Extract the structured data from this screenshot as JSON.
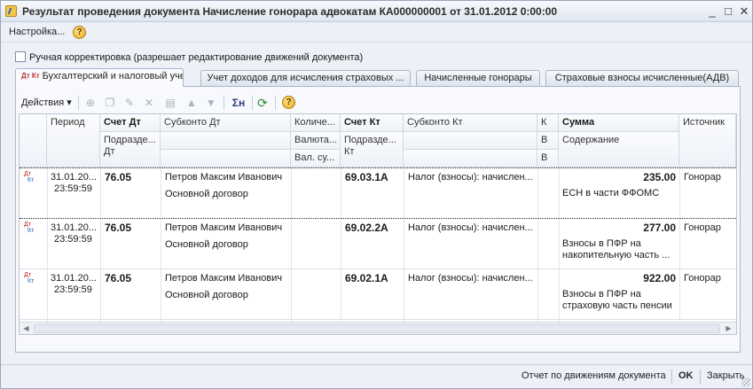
{
  "window": {
    "title": "Результат проведения документа Начисление гонорара адвокатам КА000000001 от 31.01.2012 0:00:00",
    "controls": {
      "minimize": "_",
      "maximize": "□",
      "close": "✕"
    }
  },
  "menu": {
    "settings_label": "Настройка...",
    "help": "?"
  },
  "manual_edit": {
    "label": "Ручная корректировка (разрешает редактирование движений документа)",
    "checked": false
  },
  "tabs": [
    {
      "label": "Бухгалтерский и налоговый учет",
      "icon": "Дт Кт",
      "active": true
    },
    {
      "label": "Учет доходов для исчисления страховых ...",
      "active": false
    },
    {
      "label": "Начисленные гонорары",
      "active": false
    },
    {
      "label": "Страховые взносы исчисленные(АДВ)",
      "active": false
    }
  ],
  "toolbar": {
    "actions_label": "Действия",
    "actions_arrow": "▾",
    "sum_label": "Σн",
    "help": "?"
  },
  "grid": {
    "headers": {
      "period": "Период",
      "account_dt": "Счет Дт",
      "subconto_dt": "Субконто Дт",
      "quantity": "Количе...",
      "account_kt": "Счет Кт",
      "subconto_kt": "Субконто Кт",
      "k": "К",
      "sum": "Сумма",
      "source": "Источник",
      "division_dt": "Подразде...",
      "dt": "Дт",
      "currency": "Валюта...",
      "division_kt": "Подразде...",
      "kt": "Кт",
      "v1": "В",
      "content": "Содержание",
      "val_sum": "Вал. су...",
      "v2": "В"
    },
    "rows": [
      {
        "icon_dt": "Дт",
        "icon_kt": "Кт",
        "period_date": "31.01.20...",
        "period_time": "23:59:59",
        "account_dt": "76.05",
        "subconto_dt_1": "Петров Максим Иванович",
        "subconto_dt_2": "Основной договор",
        "account_kt": "69.03.1А",
        "subconto_kt": "Налог (взносы): начислен...",
        "sum": "235.00",
        "content": "ЕСН в части ФФОМС",
        "source": "Гонорар"
      },
      {
        "icon_dt": "Дт",
        "icon_kt": "Кт",
        "period_date": "31.01.20...",
        "period_time": "23:59:59",
        "account_dt": "76.05",
        "subconto_dt_1": "Петров Максим Иванович",
        "subconto_dt_2": "Основной договор",
        "account_kt": "69.02.2А",
        "subconto_kt": "Налог (взносы): начислен...",
        "sum": "277.00",
        "content": "Взносы в ПФР на накопительную часть ...",
        "source": "Гонорар"
      },
      {
        "icon_dt": "Дт",
        "icon_kt": "Кт",
        "period_date": "31.01.20...",
        "period_time": "23:59:59",
        "account_dt": "76.05",
        "subconto_dt_1": "Петров Максим Иванович",
        "subconto_dt_2": "Основной договор",
        "account_kt": "69.02.1А",
        "subconto_kt": "Налог (взносы): начислен...",
        "sum": "922.00",
        "content": "Взносы в ПФР на страховую часть пенсии",
        "source": "Гонорар"
      }
    ]
  },
  "scrollbar": {
    "left": "◀",
    "right": "▶"
  },
  "bottom": {
    "report_label": "Отчет по движениям документа",
    "ok_label": "OK",
    "close_label": "Закрыть"
  }
}
